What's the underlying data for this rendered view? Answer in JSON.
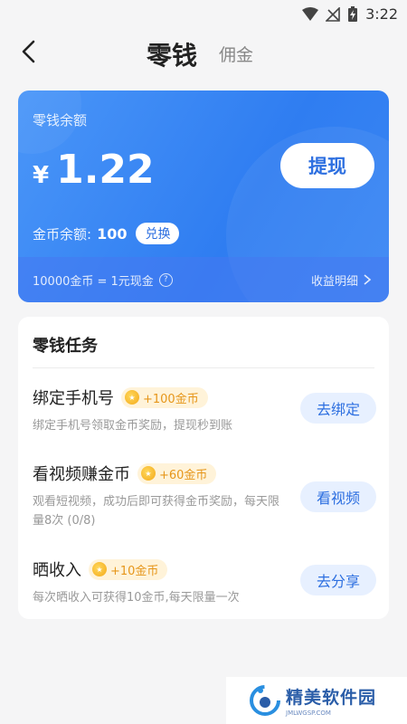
{
  "status_bar": {
    "time": "3:22"
  },
  "header": {
    "tab_active": "零钱",
    "tab_inactive": "佣金"
  },
  "balance_card": {
    "label": "零钱余额",
    "currency": "¥",
    "amount": "1.22",
    "withdraw_label": "提现",
    "coin_label": "金币余额:",
    "coin_value": "100",
    "exchange_label": "兑换",
    "rate_text": "10000金币 = 1元现金",
    "detail_link": "收益明细"
  },
  "tasks": {
    "title": "零钱任务",
    "items": [
      {
        "name": "绑定手机号",
        "reward": "+100金币",
        "desc": "绑定手机号领取金币奖励，提现秒到账",
        "button": "去绑定"
      },
      {
        "name": "看视频赚金币",
        "reward": "+60金币",
        "desc": "观看短视频，成功后即可获得金币奖励，每天限量8次 (0/8)",
        "button": "看视频"
      },
      {
        "name": "晒收入",
        "reward": "+10金币",
        "desc": "每次晒收入可获得10金币,每天限量一次",
        "button": "去分享"
      }
    ]
  },
  "watermark": {
    "title": "精美软件园",
    "subtitle": "JMLWGSP.COM"
  },
  "colors": {
    "accent": "#2f7df1",
    "reward": "#e6961a",
    "button_bg": "#e7f0ff"
  }
}
